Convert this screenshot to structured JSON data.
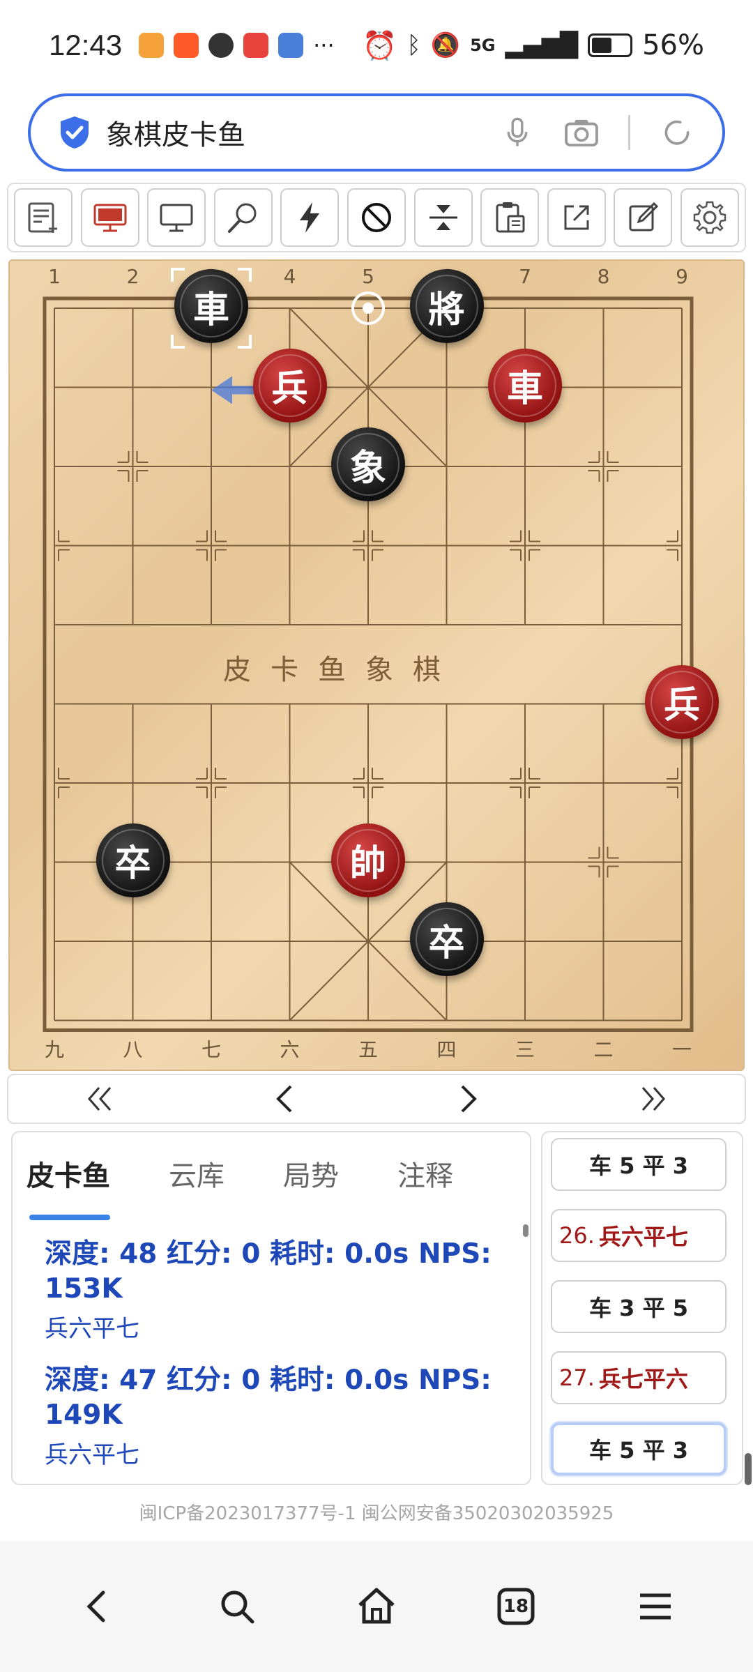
{
  "status_bar": {
    "time": "12:43",
    "more": "···",
    "network": "5G",
    "battery": "56%"
  },
  "search": {
    "query": "象棋皮卡鱼"
  },
  "toolbar": {
    "buttons": [
      "new-game",
      "red-computer",
      "black-computer",
      "analyze",
      "quick",
      "forbid",
      "flip",
      "paste",
      "share",
      "edit",
      "settings"
    ]
  },
  "board": {
    "top_labels": [
      "1",
      "2",
      "3",
      "4",
      "5",
      "6",
      "7",
      "8",
      "9"
    ],
    "bottom_labels": [
      "九",
      "八",
      "七",
      "六",
      "五",
      "四",
      "三",
      "二",
      "一"
    ],
    "river_text": "皮卡鱼象棋",
    "pieces": [
      {
        "char": "車",
        "side": "black",
        "file": 2,
        "rank": 0
      },
      {
        "char": "將",
        "side": "black",
        "file": 5,
        "rank": 0
      },
      {
        "char": "兵",
        "side": "red",
        "file": 3,
        "rank": 1
      },
      {
        "char": "車",
        "side": "red",
        "file": 6,
        "rank": 1
      },
      {
        "char": "象",
        "side": "black",
        "file": 4,
        "rank": 2
      },
      {
        "char": "兵",
        "side": "red",
        "file": 8,
        "rank": 5
      },
      {
        "char": "卒",
        "side": "black",
        "file": 1,
        "rank": 7
      },
      {
        "char": "帥",
        "side": "red",
        "file": 4,
        "rank": 7
      },
      {
        "char": "卒",
        "side": "black",
        "file": 5,
        "rank": 8
      }
    ]
  },
  "nav": {
    "first": "«",
    "prev": "‹",
    "next": "›",
    "last": "»"
  },
  "analysis": {
    "tabs": [
      "皮卡鱼",
      "云库",
      "局势",
      "注释"
    ],
    "active_tab": 0,
    "lines": [
      {
        "head": "深度: 48 红分: 0 耗时: 0.0s NPS: 153K",
        "move": "兵六平七"
      },
      {
        "head": "深度: 47 红分: 0 耗时: 0.0s NPS: 149K",
        "move": "兵六平七"
      }
    ]
  },
  "moves": [
    {
      "num": "",
      "text": "车 5 平 3",
      "side": "black"
    },
    {
      "num": "26.",
      "text": "兵六平七",
      "side": "red"
    },
    {
      "num": "",
      "text": "车 3 平 5",
      "side": "black"
    },
    {
      "num": "27.",
      "text": "兵七平六",
      "side": "red"
    },
    {
      "num": "",
      "text": "车 5 平 3",
      "side": "black",
      "current": true
    }
  ],
  "footer": {
    "icp": "闽ICP备2023017377号-1    闽公网安备35020302035925"
  },
  "bottom_nav": {
    "tabs_count": "18"
  },
  "colors": {
    "accent": "#3b6ee8",
    "analysis_text": "#1e48b8",
    "red_piece": "#b51f1f",
    "black_piece": "#1a1a1a"
  }
}
